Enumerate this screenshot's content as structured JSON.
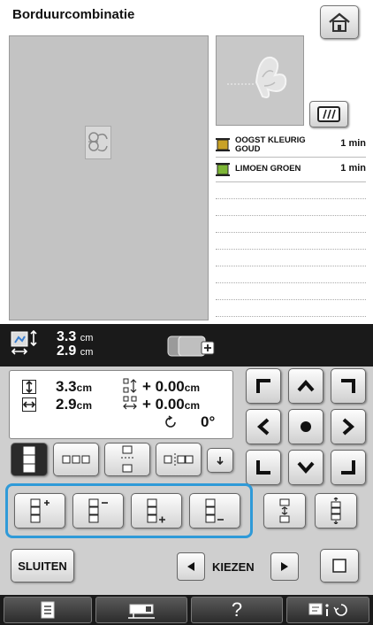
{
  "header": {
    "title": "Borduurcombinatie"
  },
  "threads": [
    {
      "name": "OOGST KLEURIG GOUD",
      "time": "1 min",
      "color": "#c9a227"
    },
    {
      "name": "LIMOEN GROEN",
      "time": "1 min",
      "color": "#7db636"
    }
  ],
  "size_bar": {
    "width": "3.3",
    "height": "2.9",
    "unit": "cm"
  },
  "info": {
    "height": "3.3",
    "width": "2.9",
    "unit": "cm",
    "offset_v": "+ 0.00",
    "offset_h": "+ 0.00",
    "angle": "0°"
  },
  "buttons": {
    "sluiten": "SLUITEN",
    "kiezen": "KIEZEN",
    "help": "?"
  },
  "icons": {
    "home": "home-icon",
    "needle": "embroidery-frame-icon"
  }
}
